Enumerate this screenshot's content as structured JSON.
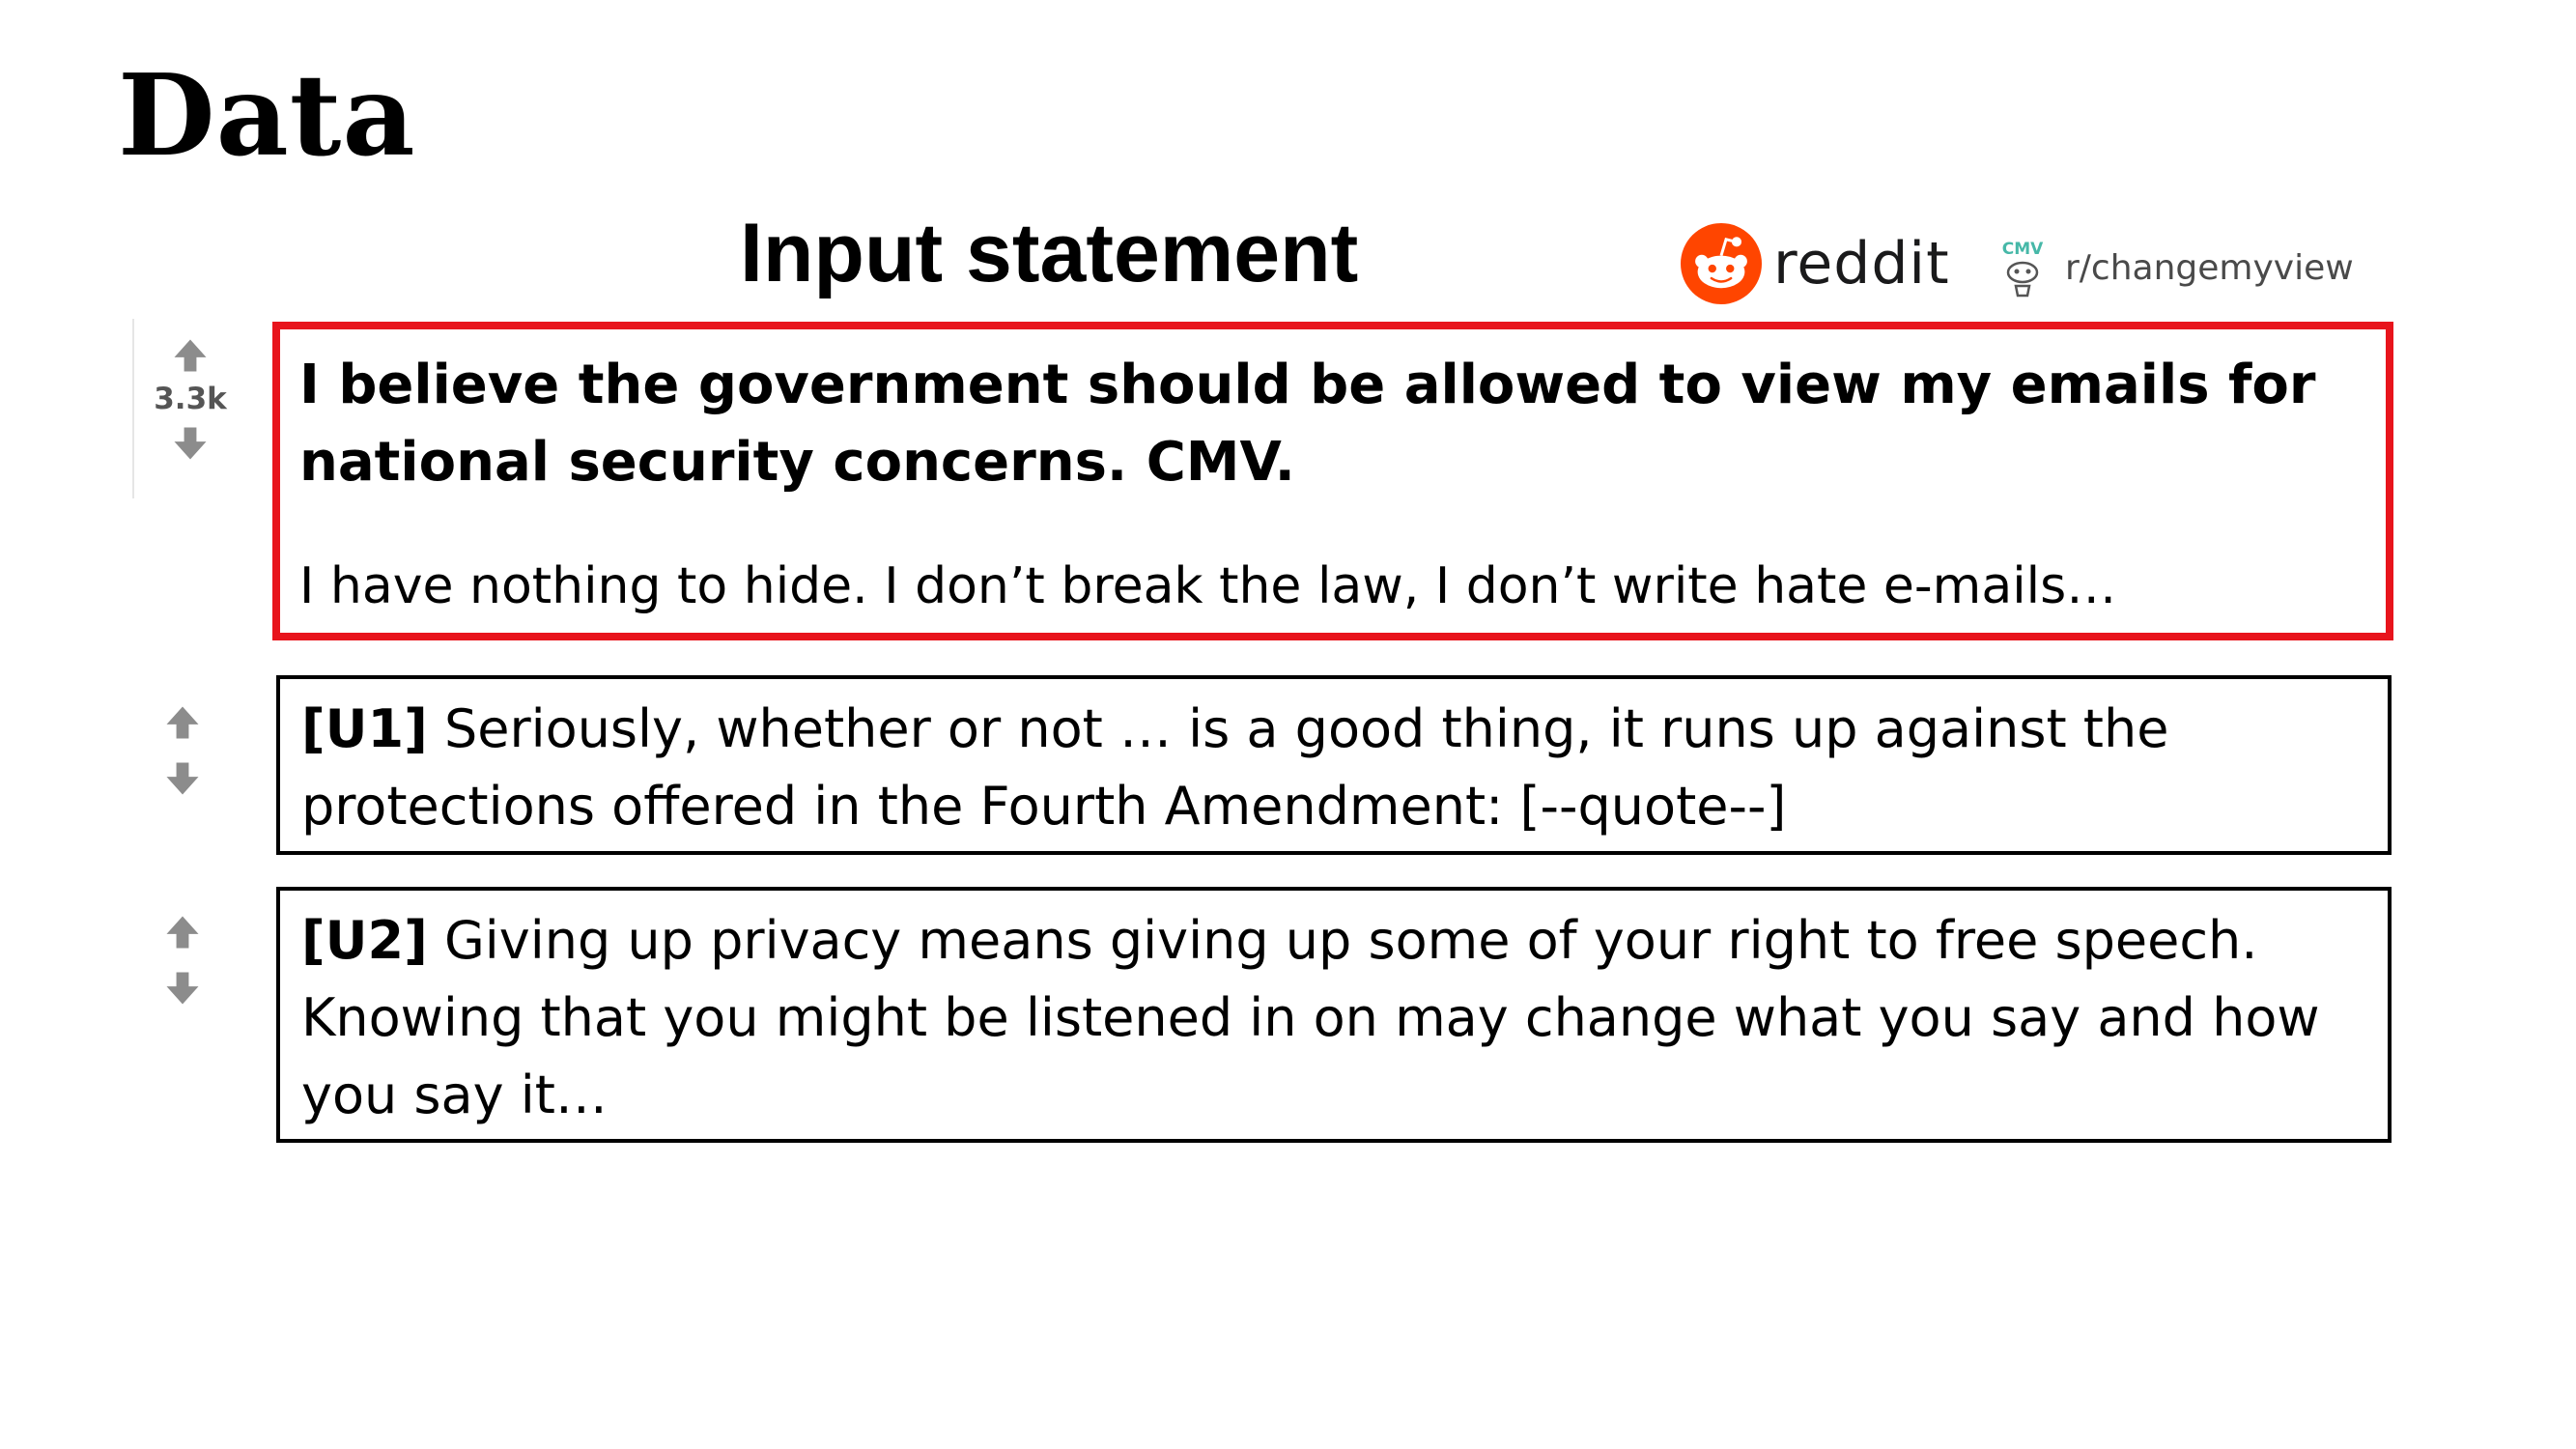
{
  "slide": {
    "title": "Data",
    "heading": "Input statement"
  },
  "branding": {
    "reddit_wordmark": "reddit",
    "subreddit": "r/changemyview",
    "cmv_logo_text": "CMV",
    "reddit_color": "#ff4500"
  },
  "post": {
    "score": "3.3k",
    "title": "I believe the government should be allowed to view my emails for national security concerns. CMV.",
    "body": "I have nothing to hide. I don’t break the law, I don’t write hate e-mails…",
    "highlight_color": "#e8141c"
  },
  "comments": [
    {
      "tag": "[U1]",
      "text": " Seriously, whether or not … is a good thing, it runs up against the protections offered in the Fourth Amendment: [--quote--]"
    },
    {
      "tag": "[U2]",
      "text": " Giving up privacy means giving up some of your right to free speech. Knowing that you might be listened in on may change what you say and how you say it…"
    }
  ],
  "icons": {
    "upvote": "arrow-up-icon",
    "downvote": "arrow-down-icon",
    "reddit": "reddit-alien-icon",
    "cmv": "cmv-snoo-icon"
  }
}
